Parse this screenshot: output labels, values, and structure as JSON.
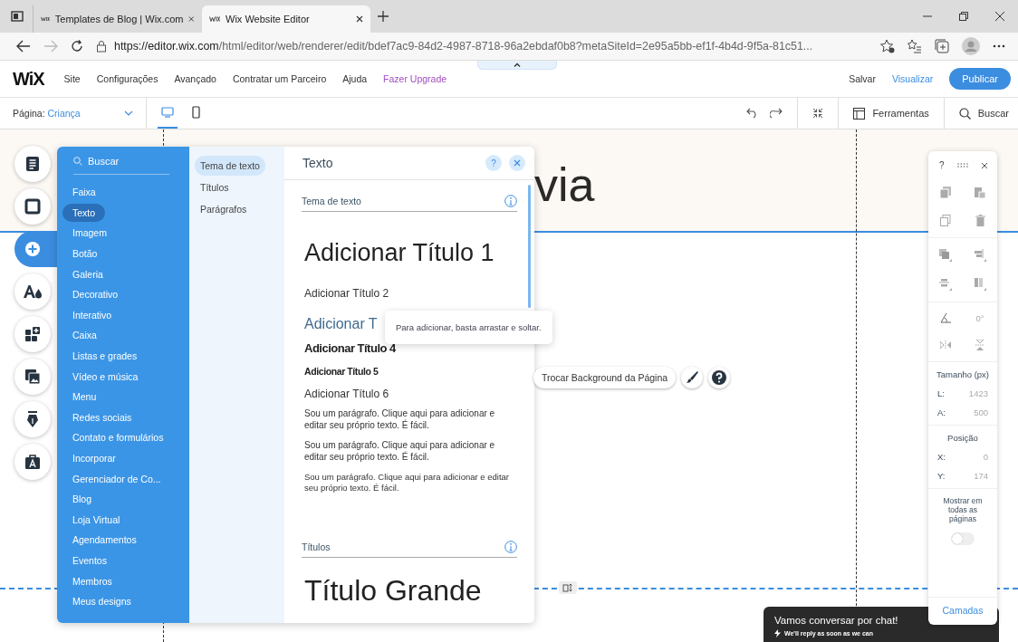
{
  "browser": {
    "tabs": [
      {
        "title": "Templates de Blog | Wix.com",
        "selected": false
      },
      {
        "title": "Wix Website Editor",
        "selected": true
      }
    ],
    "url_host": "https://editor.wix.com",
    "url_path": "/html/editor/web/renderer/edit/bdef7ac9-84d2-4987-8718-96a2ebdaf0b8?metaSiteId=2e95a5bb-ef1f-4b4d-9f5a-81c51..."
  },
  "topbar": {
    "logo": "WiX",
    "menu": [
      {
        "label": "Site",
        "kind": "plain"
      },
      {
        "label": "Configurações",
        "kind": "plain"
      },
      {
        "label": "Avançado",
        "kind": "plain"
      },
      {
        "label": "Contratar um Parceiro",
        "kind": "plain"
      },
      {
        "label": "Ajuda",
        "kind": "plain"
      },
      {
        "label": "Fazer Upgrade",
        "kind": "upgrade"
      }
    ],
    "save": "Salvar",
    "preview": "Visualizar",
    "publish": "Publicar"
  },
  "pagebar": {
    "page_label": "Página:",
    "page_name": "Criança",
    "views": [
      {
        "kind": "desktop",
        "selected": true
      },
      {
        "kind": "mobile",
        "selected": false
      }
    ],
    "tools": "Ferramentas",
    "search": "Buscar"
  },
  "rail": [
    {
      "kind": "pages",
      "selected": false
    },
    {
      "kind": "background",
      "selected": false
    },
    {
      "kind": "add",
      "selected": true
    },
    {
      "kind": "design",
      "selected": false
    },
    {
      "kind": "apps",
      "selected": false
    },
    {
      "kind": "media",
      "selected": false
    },
    {
      "kind": "blog",
      "selected": false
    },
    {
      "kind": "business",
      "selected": false
    }
  ],
  "add_panel": {
    "search": "Buscar",
    "categories": [
      {
        "label": "Faixa",
        "selected": false
      },
      {
        "label": "Texto",
        "selected": true
      },
      {
        "label": "Imagem",
        "selected": false
      },
      {
        "label": "Botão",
        "selected": false
      },
      {
        "label": "Galeria",
        "selected": false
      },
      {
        "label": "Decorativo",
        "selected": false
      },
      {
        "label": "Interativo",
        "selected": false
      },
      {
        "label": "Caixa",
        "selected": false
      },
      {
        "label": "Listas e grades",
        "selected": false
      },
      {
        "label": "Vídeo e música",
        "selected": false
      },
      {
        "label": "Menu",
        "selected": false
      },
      {
        "label": "Redes sociais",
        "selected": false
      },
      {
        "label": "Contato e formulários",
        "selected": false
      },
      {
        "label": "Incorporar",
        "selected": false
      },
      {
        "label": "Gerenciador de Co...",
        "selected": false
      },
      {
        "label": "Blog",
        "selected": false
      },
      {
        "label": "Loja Virtual",
        "selected": false
      },
      {
        "label": "Agendamentos",
        "selected": false
      },
      {
        "label": "Eventos",
        "selected": false
      },
      {
        "label": "Membros",
        "selected": false
      },
      {
        "label": "Meus designs",
        "selected": false
      }
    ],
    "subcategories": [
      {
        "label": "Tema de texto",
        "selected": true
      },
      {
        "label": "Títulos",
        "selected": false
      },
      {
        "label": "Parágrafos",
        "selected": false
      }
    ],
    "title": "Texto",
    "help": "?",
    "sections": [
      {
        "title": "Tema de texto",
        "items": [
          {
            "kind": "h1",
            "text": "Adicionar Título 1"
          },
          {
            "kind": "h2",
            "text": "Adicionar Título 2"
          },
          {
            "kind": "h3",
            "text": "Adicionar T"
          },
          {
            "kind": "h4",
            "text": "Adicionar Título 4"
          },
          {
            "kind": "h5",
            "text": "Adicionar Título 5"
          },
          {
            "kind": "h6",
            "text": "Adicionar Título 6"
          },
          {
            "kind": "p1",
            "text": "Sou um parágrafo. Clique aqui para adicionar e editar seu próprio texto. É fácil."
          },
          {
            "kind": "p2",
            "text": "Sou um parágrafo. Clique aqui para adicionar e editar seu próprio texto. É fácil."
          },
          {
            "kind": "p3",
            "text": "Sou um parágrafo. Clique aqui para adicionar e editar seu próprio texto. É fácil."
          }
        ]
      },
      {
        "title": "Títulos",
        "items": [
          {
            "kind": "display",
            "text": "Título Grande"
          }
        ]
      }
    ]
  },
  "tooltip": "Para adicionar, basta arrastar e soltar.",
  "canvas": {
    "heading_fragment": "via",
    "background_button": "Trocar Background da Página"
  },
  "inspector": {
    "help": "?",
    "rotation": "0°",
    "size_title": "Tamanho (px)",
    "size": [
      {
        "label": "L:",
        "value": "1423"
      },
      {
        "label": "A:",
        "value": "500"
      }
    ],
    "position_title": "Posição",
    "position": [
      {
        "label": "X:",
        "value": "0"
      },
      {
        "label": "Y:",
        "value": "174"
      }
    ],
    "show_all": {
      "label": "Mostrar em todas as páginas",
      "on": false
    },
    "layers": "Camadas"
  },
  "chat": {
    "title": "Vamos conversar por chat!",
    "subtitle": "We'll reply as soon as we can"
  }
}
